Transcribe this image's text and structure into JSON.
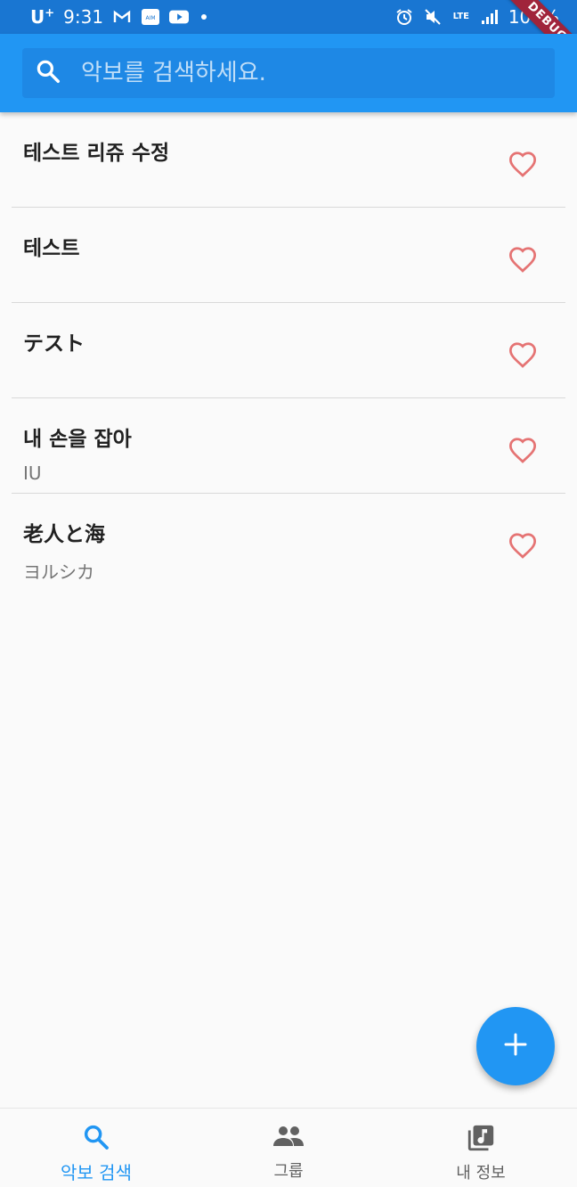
{
  "status_bar": {
    "carrier": "U",
    "carrier_sup": "+",
    "time": "9:31",
    "aim_label": "AIM",
    "network": "LTE",
    "battery": "100%"
  },
  "debug_banner": "DEBUG",
  "search": {
    "placeholder": "악보를 검색하세요.",
    "value": ""
  },
  "songs": [
    {
      "title": "테스트 리쥬 수정",
      "artist": ""
    },
    {
      "title": "테스트",
      "artist": ""
    },
    {
      "title": "テスト",
      "artist": ""
    },
    {
      "title": "내 손을 잡아",
      "artist": "IU"
    },
    {
      "title": "老人と海",
      "artist": "ヨルシカ"
    }
  ],
  "bottom_nav": {
    "items": [
      {
        "label": "악보 검색",
        "active": true
      },
      {
        "label": "그룹",
        "active": false
      },
      {
        "label": "내 정보",
        "active": false
      }
    ]
  },
  "colors": {
    "primary": "#2196f3",
    "status_bar": "#1976d2",
    "heart": "#e57373"
  }
}
